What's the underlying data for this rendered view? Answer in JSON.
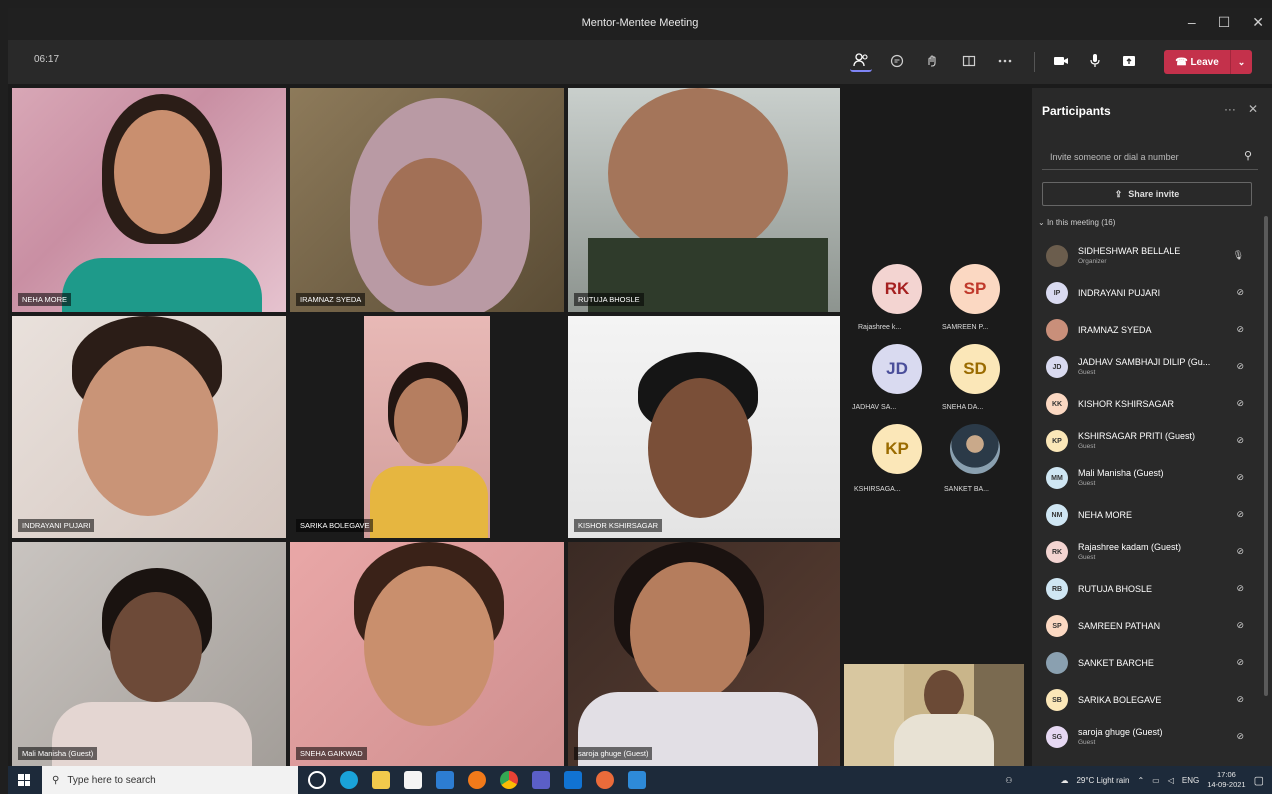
{
  "window": {
    "title": "Mentor-Mentee Meeting",
    "min": "–",
    "max": "☐",
    "close": "✕"
  },
  "toolbar": {
    "timer": "06:17",
    "leave_label": "Leave"
  },
  "tiles": [
    {
      "name": "NEHA MORE"
    },
    {
      "name": "IRAMNAZ SYEDA"
    },
    {
      "name": "RUTUJA BHOSLE"
    },
    {
      "name": "INDRAYANI PUJARI"
    },
    {
      "name": "SARIKA BOLEGAVE"
    },
    {
      "name": "KISHOR KSHIRSAGAR"
    },
    {
      "name": "Mali Manisha (Guest)"
    },
    {
      "name": "SNEHA GAIKWAD"
    },
    {
      "name": "saroja ghuge (Guest)"
    }
  ],
  "avatars": [
    {
      "initials": "RK",
      "name": "Rajashree k...",
      "color": "#f3d4d1",
      "text": "#a52020"
    },
    {
      "initials": "SP",
      "name": "SAMREEN P...",
      "color": "#fbd8c2",
      "text": "#c0392b"
    },
    {
      "initials": "JD",
      "name": "JADHAV SA...",
      "color": "#d9daf0",
      "text": "#4a4e9a"
    },
    {
      "initials": "SD",
      "name": "SNEHA DA...",
      "color": "#fbe7b8",
      "text": "#9a6b00"
    },
    {
      "initials": "KP",
      "name": "KSHIRSAGA...",
      "color": "#fbe7b8",
      "text": "#9a6b00"
    },
    {
      "initials": "",
      "name": "SANKET BA...",
      "color": "#8aa0b0",
      "text": "#fff"
    }
  ],
  "participants_panel": {
    "title": "Participants",
    "invite_placeholder": "Invite someone or dial a number",
    "share_label": "Share invite",
    "section_label": "In this meeting (16)",
    "people": [
      {
        "initials": "",
        "name": "SIDHESHWAR BELLALE",
        "role": "Organizer",
        "color": "#6b5d4d"
      },
      {
        "initials": "IP",
        "name": "INDRAYANI PUJARI",
        "role": "",
        "color": "#d9daf0"
      },
      {
        "initials": "",
        "name": "IRAMNAZ SYEDA",
        "role": "",
        "color": "#c98f7a"
      },
      {
        "initials": "JD",
        "name": "JADHAV SAMBHAJI DILIP (Gu...",
        "role": "Guest",
        "color": "#d9daf0"
      },
      {
        "initials": "KK",
        "name": "KISHOR KSHIRSAGAR",
        "role": "",
        "color": "#fbd8c2"
      },
      {
        "initials": "KP",
        "name": "KSHIRSAGAR PRITI (Guest)",
        "role": "Guest",
        "color": "#fbe7b8"
      },
      {
        "initials": "MM",
        "name": "Mali Manisha (Guest)",
        "role": "Guest",
        "color": "#cfe6f3"
      },
      {
        "initials": "NM",
        "name": "NEHA MORE",
        "role": "",
        "color": "#cfe6f3"
      },
      {
        "initials": "RK",
        "name": "Rajashree kadam (Guest)",
        "role": "Guest",
        "color": "#f3d4d1"
      },
      {
        "initials": "RB",
        "name": "RUTUJA BHOSLE",
        "role": "",
        "color": "#cfe6f3"
      },
      {
        "initials": "SP",
        "name": "SAMREEN PATHAN",
        "role": "",
        "color": "#fbd8c2"
      },
      {
        "initials": "",
        "name": "SANKET BARCHE",
        "role": "",
        "color": "#8aa0b0"
      },
      {
        "initials": "SB",
        "name": "SARIKA BOLEGAVE",
        "role": "",
        "color": "#fbe7b8"
      },
      {
        "initials": "SG",
        "name": "saroja ghuge (Guest)",
        "role": "Guest",
        "color": "#e6d8f3"
      }
    ]
  },
  "taskbar": {
    "search_placeholder": "Type here to search",
    "weather": "29°C Light rain",
    "lang": "ENG",
    "time": "17:06",
    "date": "14-09-2021"
  }
}
